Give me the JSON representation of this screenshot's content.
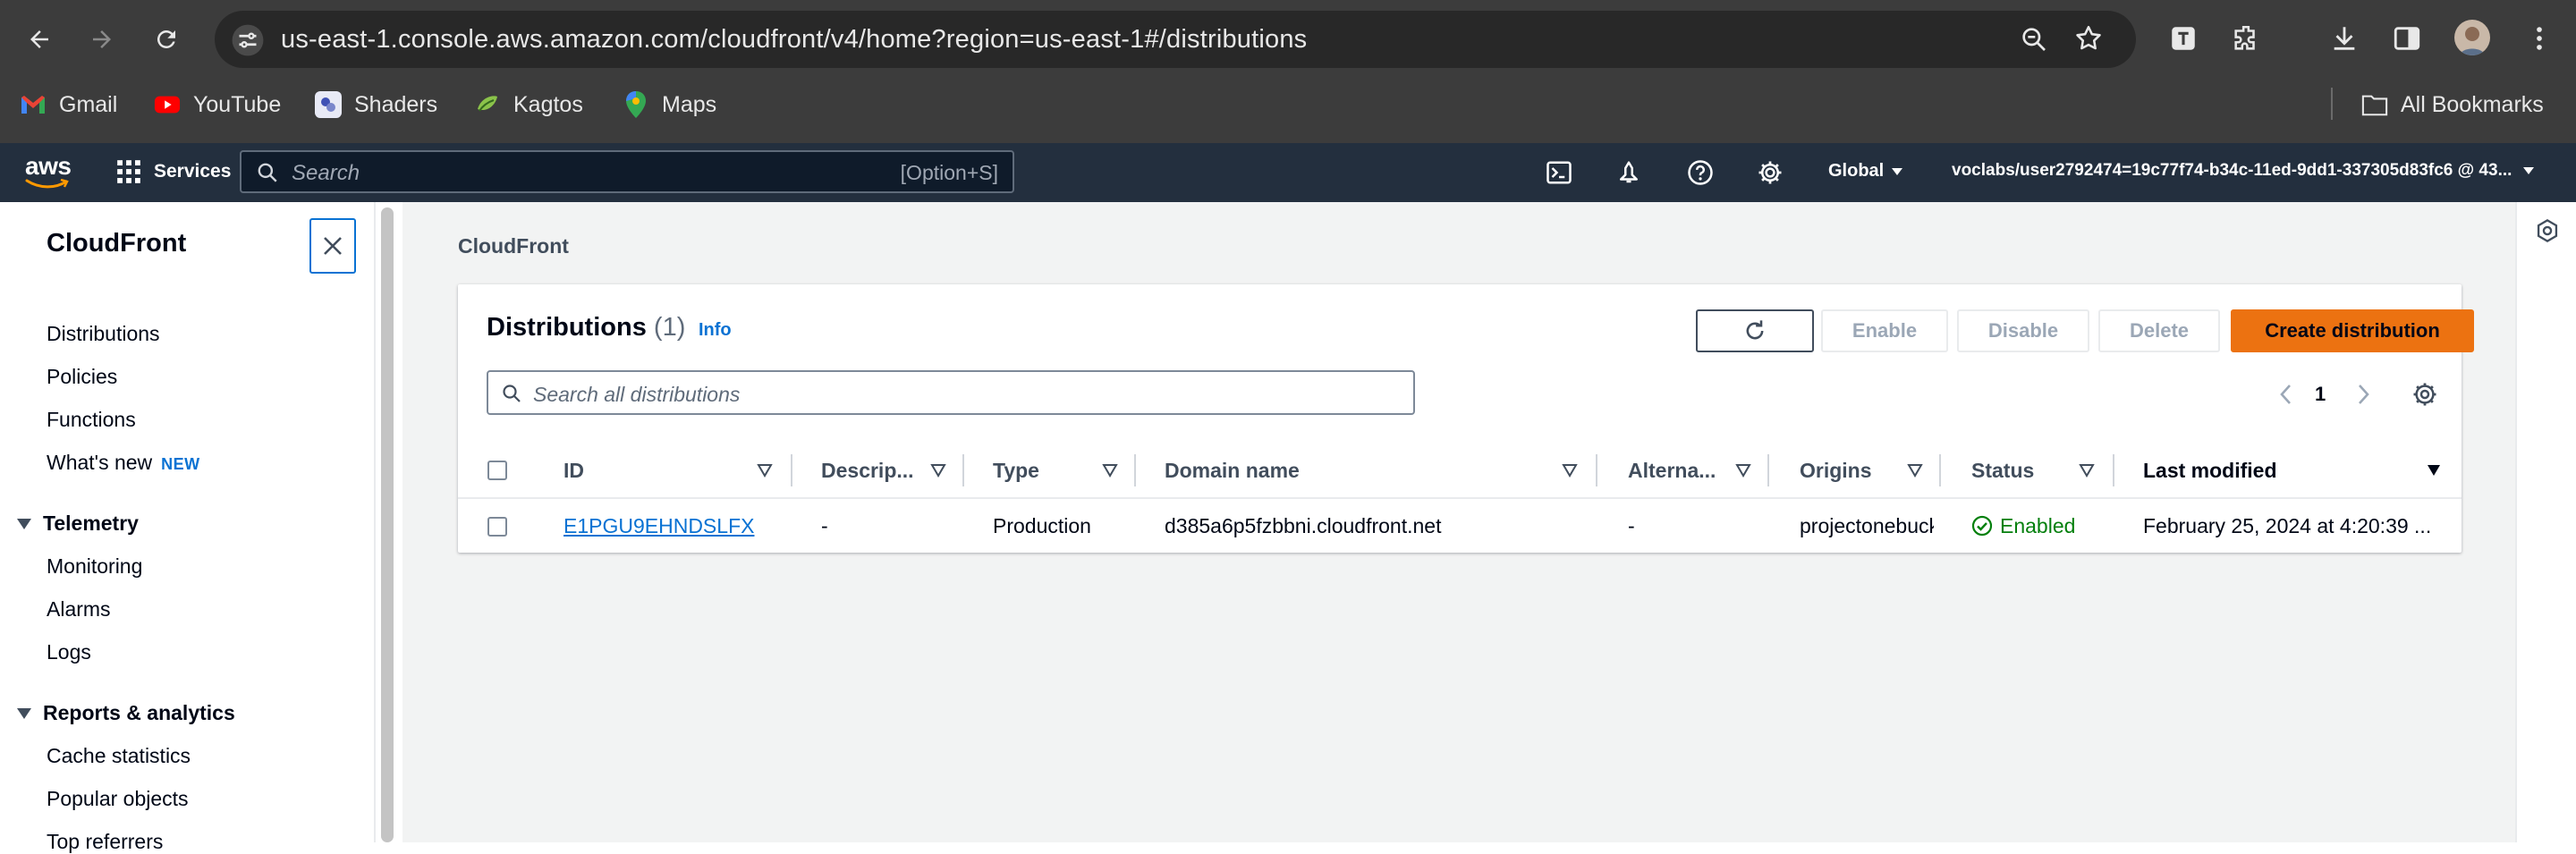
{
  "browser": {
    "url": "us-east-1.console.aws.amazon.com/cloudfront/v4/home?region=us-east-1#/distributions",
    "bookmarks": [
      {
        "label": "Gmail",
        "icon": "gmail-icon"
      },
      {
        "label": "YouTube",
        "icon": "youtube-icon"
      },
      {
        "label": "Shaders",
        "icon": "shaders-icon"
      },
      {
        "label": "Kagtos",
        "icon": "kagtos-icon"
      },
      {
        "label": "Maps",
        "icon": "maps-icon"
      }
    ],
    "all_bookmarks": "All Bookmarks"
  },
  "aws_nav": {
    "logo": "aws",
    "services": "Services",
    "search_placeholder": "Search",
    "search_shortcut": "[Option+S]",
    "region": "Global",
    "account": "voclabs/user2792474=19c77f74-b34c-11ed-9dd1-337305d83fc6 @ 43..."
  },
  "sidebar": {
    "title": "CloudFront",
    "items": [
      "Distributions",
      "Policies",
      "Functions",
      "What's new"
    ],
    "new_badge": "NEW",
    "sections": [
      {
        "title": "Telemetry",
        "items": [
          "Monitoring",
          "Alarms",
          "Logs"
        ]
      },
      {
        "title": "Reports & analytics",
        "items": [
          "Cache statistics",
          "Popular objects",
          "Top referrers"
        ]
      }
    ]
  },
  "main": {
    "breadcrumb": "CloudFront",
    "panel": {
      "title": "Distributions",
      "count": "(1)",
      "info": "Info",
      "buttons": {
        "enable": "Enable",
        "disable": "Disable",
        "delete": "Delete",
        "create": "Create distribution"
      },
      "search_placeholder": "Search all distributions",
      "page": "1"
    },
    "table": {
      "columns": [
        "ID",
        "Descrip...",
        "Type",
        "Domain name",
        "Alterna...",
        "Origins",
        "Status",
        "Last modified"
      ],
      "rows": [
        {
          "id": "E1PGU9EHNDSLFX",
          "description": "-",
          "type": "Production",
          "domain": "d385a6p5fzbbni.cloudfront.net",
          "alternate": "-",
          "origins": "projectonebucket",
          "status": "Enabled",
          "last_modified": "February 25, 2024 at 4:20:39 ..."
        }
      ]
    }
  },
  "colors": {
    "aws_nav": "#232f3e",
    "primary_button": "#ec7211",
    "link": "#0972d3",
    "success": "#037f0c"
  }
}
